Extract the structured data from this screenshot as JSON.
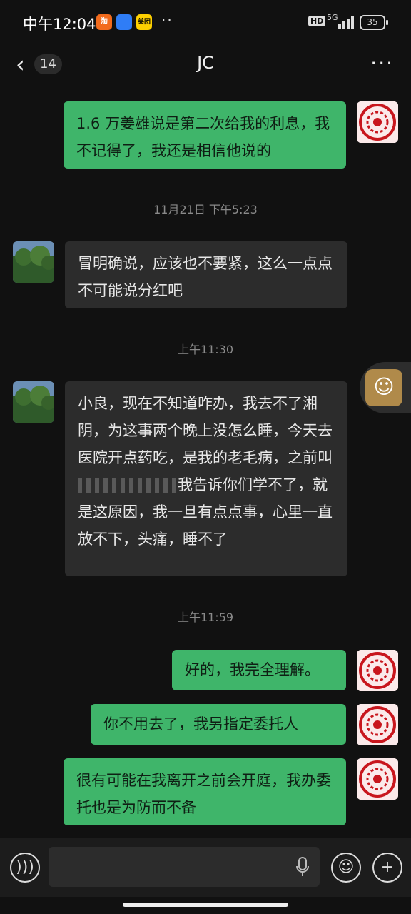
{
  "status_bar": {
    "time": "中午12:04",
    "app_icons": [
      "淘",
      "",
      "美团"
    ],
    "hd": "HD",
    "network": "5G",
    "battery": "35"
  },
  "nav": {
    "back_count": "14",
    "title": "JC",
    "more": "···"
  },
  "messages": [
    {
      "type": "sent",
      "text": "1.6 万姜雄说是第二次给我的利息，我不记得了，我还是相信他说的"
    },
    {
      "type": "time",
      "text": "11月21日 下午5:23"
    },
    {
      "type": "recv",
      "text": "冒明确说，应该也不要紧，这么一点点不可能说分红吧"
    },
    {
      "type": "time",
      "text": "上午11:30"
    },
    {
      "type": "recv",
      "text_a": "小良，现在不知道咋办，我去不了湘阴，为这事两个晚上没怎么睡，今天去医院开点药吃，是我的老毛病，之前叫",
      "text_b": "我告诉你们学不了，就是这原因，我一旦有点点事，心里一直放不下，头痛，睡不了"
    },
    {
      "type": "time",
      "text": "上午11:59"
    },
    {
      "type": "sent",
      "text": "好的，我完全理解。"
    },
    {
      "type": "sent",
      "text": "你不用去了，我另指定委托人"
    },
    {
      "type": "sent",
      "text": "很有可能在我离开之前会开庭，我办委托也是为防而不备"
    }
  ],
  "colors": {
    "background": "#111111",
    "sent_bubble": "#3fb56a",
    "recv_bubble": "#2c2c2c",
    "timestamp": "#8a8a8a"
  },
  "icons": {
    "voice": "voice-icon",
    "mic": "mic-icon",
    "emoji": "emoji-icon",
    "add": "plus-icon",
    "accessibility": "accessibility-icon"
  }
}
